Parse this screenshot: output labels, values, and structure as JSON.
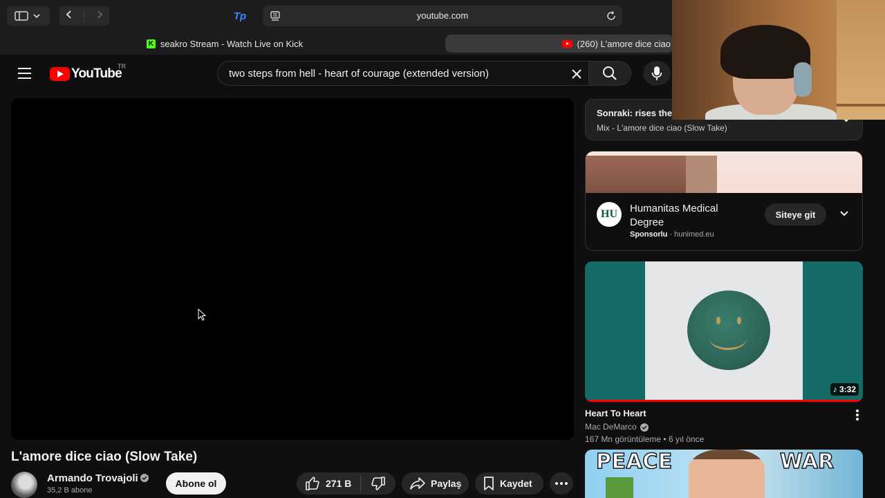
{
  "browser": {
    "address": "youtube.com",
    "tabs": [
      {
        "label": "seakro Stream - Watch Live on Kick"
      },
      {
        "label": "(260) L'amore dice ciao"
      }
    ],
    "extension_label": "Tp"
  },
  "masthead": {
    "logo_word": "YouTube",
    "region": "TR",
    "search_value": "two steps from hell - heart of courage (extended version)"
  },
  "video": {
    "title": "L'amore dice ciao (Slow Take)",
    "channel": "Armando Trovajoli",
    "subscribers": "35,2 B abone",
    "subscribe_label": "Abone ol",
    "likes": "271 B",
    "share_label": "Paylaş",
    "save_label": "Kaydet"
  },
  "up_next": {
    "title": "Sonraki: rises the",
    "subtitle": "Mix - L'amore dice ciao (Slow Take)"
  },
  "ad": {
    "logo_text": "HU",
    "title": "Humanitas Medical Degree",
    "sponsored_label": "Sponsorlu",
    "domain": "hunimed.eu",
    "cta_label": "Siteye git"
  },
  "recommendations": [
    {
      "title": "Heart To Heart",
      "channel": "Mac DeMarco",
      "stats": "167 Mn görüntüleme • 6 yıl önce",
      "duration": "♪ 3:32",
      "watched_fraction": 1.0
    },
    {
      "thumb_text_left": "PEACE",
      "thumb_text_right": "WAR"
    }
  ],
  "colors": {
    "brand_red": "#ff0000",
    "background": "#0f0f0f",
    "kick_green": "#53fc18"
  }
}
